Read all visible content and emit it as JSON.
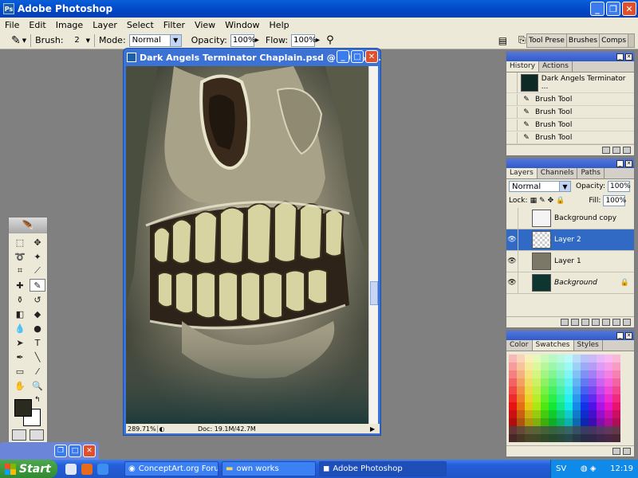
{
  "app": {
    "title": "Adobe Photoshop"
  },
  "menu": [
    "File",
    "Edit",
    "Image",
    "Layer",
    "Select",
    "Filter",
    "View",
    "Window",
    "Help"
  ],
  "options": {
    "brush_label": "Brush:",
    "brush_size": "2",
    "mode_label": "Mode:",
    "mode_value": "Normal",
    "opacity_label": "Opacity:",
    "opacity_value": "100%",
    "flow_label": "Flow:",
    "flow_value": "100%",
    "well_tabs": [
      "Tool Prese",
      "Brushes",
      "Comps"
    ]
  },
  "document": {
    "title": "Dark Angels Terminator Chaplain.psd @ 290% (L...",
    "zoom": "289.71%",
    "doc_size": "Doc: 19.1M/42.7M"
  },
  "history": {
    "tabs": [
      "History",
      "Actions"
    ],
    "snapshot": "Dark Angels Terminator ...",
    "items": [
      "Brush Tool",
      "Brush Tool",
      "Brush Tool",
      "Brush Tool"
    ]
  },
  "layers": {
    "tabs": [
      "Layers",
      "Channels",
      "Paths"
    ],
    "blend_mode": "Normal",
    "opacity_label": "Opacity:",
    "opacity_value": "100%",
    "lock_label": "Lock:",
    "fill_label": "Fill:",
    "fill_value": "100%",
    "items": [
      {
        "name": "Background copy",
        "visible": false,
        "selected": false
      },
      {
        "name": "Layer 2",
        "visible": true,
        "selected": true
      },
      {
        "name": "Layer 1",
        "visible": true,
        "selected": false
      },
      {
        "name": "Background",
        "visible": true,
        "selected": false
      }
    ]
  },
  "swatch_panel": {
    "tabs": [
      "Color",
      "Swatches",
      "Styles"
    ]
  },
  "taskbar": {
    "start_label": "Start",
    "tasks": [
      "ConceptArt.org Foru...",
      "own works",
      "Adobe Photoshop"
    ],
    "language": "SV",
    "clock": "12:19"
  }
}
